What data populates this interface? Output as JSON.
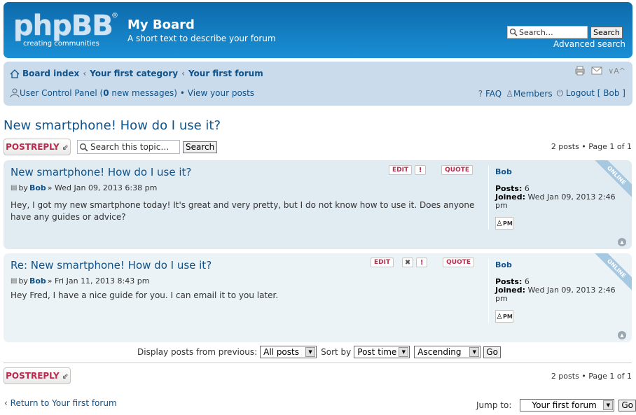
{
  "header": {
    "logo_text": "phpBB",
    "logo_reg": "®",
    "logo_sub": "creating communities",
    "site_title": "My Board",
    "site_desc": "A short text to describe your forum",
    "search_placeholder": "Search…",
    "search_button": "Search",
    "advanced_search": "Advanced search"
  },
  "navbar": {
    "crumbs": [
      "Board index",
      "Your first category",
      "Your first forum"
    ],
    "ucp": "User Control Panel (",
    "ucp_count": "0",
    "ucp_after": " new messages)",
    "view_posts": "• View your posts",
    "faq": "FAQ",
    "members": "Members",
    "logout": "Logout [ Bob ]"
  },
  "topic": {
    "title": "New smartphone! How do I use it?",
    "reply_label": "POSTREPLY",
    "search_placeholder": "Search this topic…",
    "search_button": "Search",
    "pagination": "2 posts • Page 1 of 1"
  },
  "posts": [
    {
      "subject": "New smartphone! How do I use it?",
      "by": "by",
      "author": "Bob",
      "date": "» Wed Jan 09, 2013 6:38 pm",
      "body": "Hey, I got my new smartphone today! It's great and very pretty, but I do not know how to use it. Does anyone have any guides or advice?",
      "edit": "EDIT",
      "quote": "QUOTE",
      "profile_name": "Bob",
      "posts_label": "Posts:",
      "posts_count": "6",
      "joined_label": "Joined:",
      "joined": "Wed Jan 09, 2013 2:46 pm",
      "pm": "PM",
      "online": "ONLINE"
    },
    {
      "subject": "Re: New smartphone! How do I use it?",
      "by": "by",
      "author": "Bob",
      "date": "» Fri Jan 11, 2013 8:43 pm",
      "body": "Hey Fred, I have a nice guide for you. I can email it to you later.",
      "edit": "EDIT",
      "quote": "QUOTE",
      "profile_name": "Bob",
      "posts_label": "Posts:",
      "posts_count": "6",
      "joined_label": "Joined:",
      "joined": "Wed Jan 09, 2013 2:46 pm",
      "pm": "PM",
      "online": "ONLINE"
    }
  ],
  "display": {
    "label": "Display posts from previous:",
    "all_posts": "All posts",
    "sort_label": "Sort by",
    "sort_value": "Post time",
    "order_value": "Ascending",
    "go": "Go"
  },
  "footer": {
    "reply_label": "POSTREPLY",
    "pagination": "2 posts • Page 1 of 1",
    "return_link": "Return to Your first forum",
    "jump_label": "Jump to:",
    "jump_value": "Your first forum",
    "go": "Go"
  },
  "colors": {
    "header_bg": "#0f76b9",
    "navbar_bg": "#cadceb",
    "link": "#105289",
    "button_text": "#bc2a4d"
  }
}
